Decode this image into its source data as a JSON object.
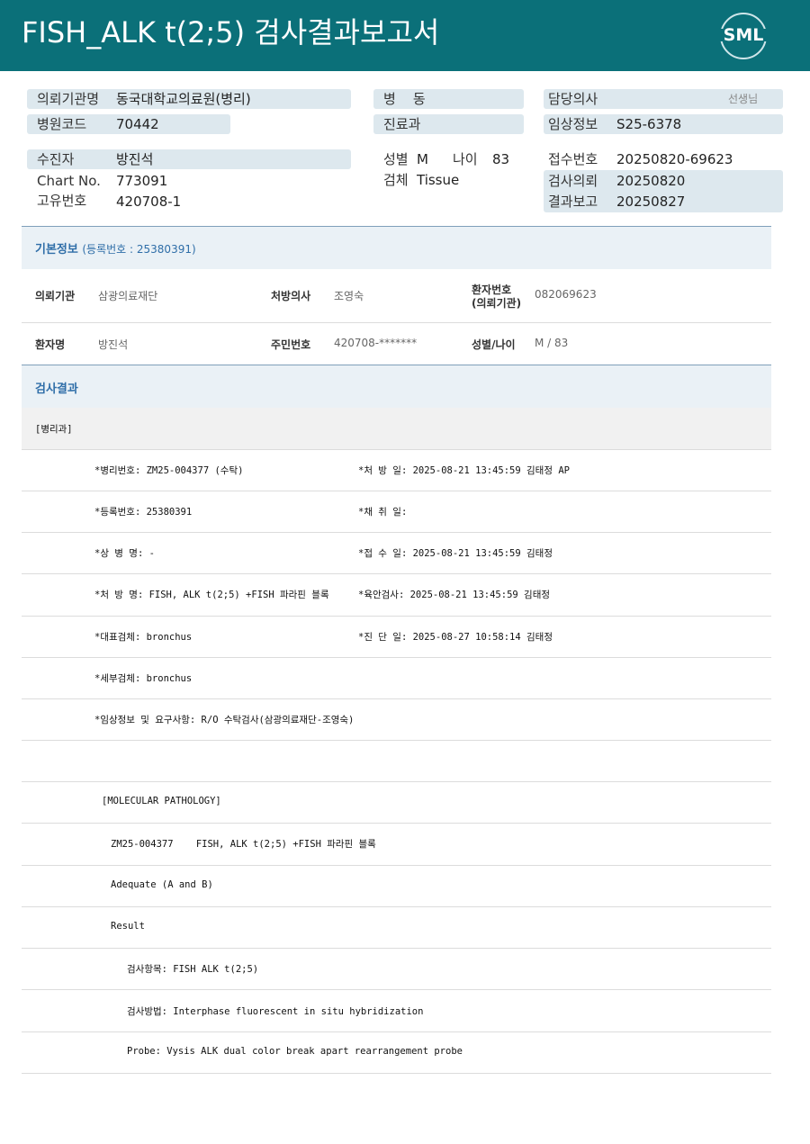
{
  "header": {
    "title": "FISH_ALK t(2;5) 검사결과보고서",
    "logo": "SML"
  },
  "top": {
    "institution_label": "의뢰기관명",
    "institution": "동국대학교의료원(병리)",
    "hospital_code_label": "병원코드",
    "hospital_code": "70442",
    "ward_label": "병    동",
    "ward": "",
    "dept_label": "진료과",
    "dept": "",
    "doctor_label": "담당의사",
    "doctor_suffix": "선생님",
    "clinical_label": "임상정보",
    "clinical": "S25-6378",
    "patient_label": "수진자",
    "patient": "방진석",
    "chart_label": "Chart No.",
    "chart": "773091",
    "unique_label": "고유번호",
    "unique": "420708-1",
    "sex_label": "성별",
    "sex": "M",
    "age_label": "나이",
    "age": "83",
    "specimen_label": "검체",
    "specimen": "Tissue",
    "receipt_label": "접수번호",
    "receipt": "20250820-69623",
    "request_label": "검사의뢰",
    "request": "20250820",
    "report_label": "결과보고",
    "report": "20250827"
  },
  "basic": {
    "title": "기본정보",
    "reg": "(등록번호 : 25380391)",
    "r1": {
      "l1": "의뢰기관",
      "v1": "삼광의료재단",
      "l2": "처방의사",
      "v2": "조영숙",
      "l3a": "환자번호",
      "l3b": "(의뢰기관)",
      "v3": "082069623"
    },
    "r2": {
      "l1": "환자명",
      "v1": "방진석",
      "l2": "주민번호",
      "v2": "420708-*******",
      "l3": "성별/나이",
      "v3": "M / 83"
    }
  },
  "results": {
    "title": "검사결과",
    "dept": "[병리과]",
    "lines": [
      {
        "left": "*병리번호: ZM25-004377 (수탁)",
        "right": "*처 방 일: 2025-08-21 13:45:59  김태정 AP"
      },
      {
        "left": "*등록번호: 25380391",
        "right": "*채 취 일:"
      },
      {
        "left": "*상 병 명: -",
        "right": "*접 수 일: 2025-08-21 13:45:59  김태정"
      },
      {
        "left": "*처 방 명: FISH, ALK t(2;5) +FISH 파라핀 블록",
        "right": "*육안검사: 2025-08-21 13:45:59  김태정"
      },
      {
        "left": "*대표검체: bronchus",
        "right": "*진 단 일: 2025-08-27 10:58:14  김태정"
      },
      {
        "left": "*세부검체: bronchus",
        "right": ""
      },
      {
        "left": "*임상정보 및 요구사항: R/O 수탁검사(삼광의료재단-조영숙)",
        "right": ""
      }
    ],
    "molecular": "[MOLECULAR PATHOLOGY]",
    "m1": "ZM25-004377    FISH, ALK t(2;5) +FISH 파라핀 블록",
    "m2": "Adequate (A and B)",
    "m3": "Result",
    "m4": "검사항목: FISH ALK t(2;5)",
    "m5": "검사방법: Interphase fluorescent in situ hybridization",
    "m6": "Probe: Vysis ALK dual color break apart rearrangement probe"
  }
}
